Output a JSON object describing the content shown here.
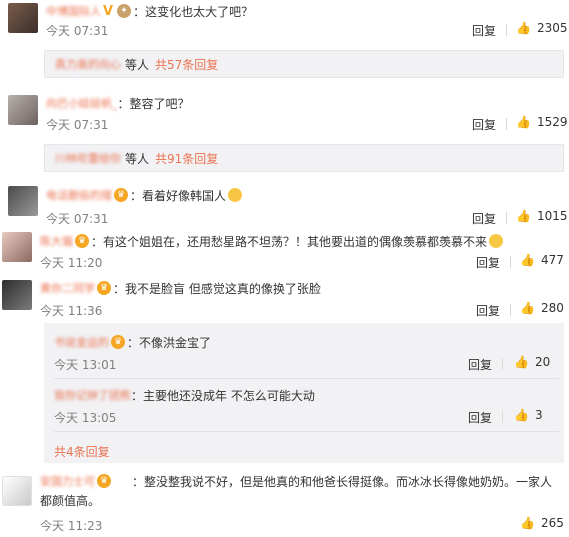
{
  "comments": [
    {
      "username": "中博国际人",
      "text": "：这变化也太大了吧？",
      "time": "今天 07:31",
      "reply_label": "回复",
      "likes": "2305",
      "reply_summary": {
        "users": "真力奥的向心",
        "suffix": "等人",
        "count_label": "共57条回复"
      }
    },
    {
      "username": "向巴小娃娃帆_",
      "text": "：整容了吧？",
      "time": "今天 07:31",
      "reply_label": "回复",
      "likes": "1529",
      "reply_summary": {
        "users": "川林吹蕾给你",
        "suffix": "等人",
        "count_label": "共91条回复"
      }
    },
    {
      "username": "电话删俗的摆",
      "text": "：看着好像韩国人",
      "time": "今天 07:31",
      "reply_label": "回复",
      "likes": "1015"
    },
    {
      "username": "陈大猫",
      "text": "：有这个姐姐在，还用愁星路不坦荡？！其他要出道的偶像羡慕都羡慕不来",
      "time": "今天 11:20",
      "reply_label": "回复",
      "likes": "477"
    },
    {
      "username": "黄你二同学",
      "text": "：我不是脸盲 但感觉这真的像换了张脸",
      "time": "今天 11:36",
      "reply_label": "回复",
      "likes": "280",
      "nested": [
        {
          "username": "书说金运的",
          "text": "：不像洪金宝了",
          "time": "今天 13:01",
          "reply_label": "回复",
          "likes": "20"
        },
        {
          "username": "我你记钟了团熊",
          "text": "：主要他还没成年 不怎么可能大动",
          "time": "今天 13:05",
          "reply_label": "回复",
          "likes": "3"
        }
      ],
      "more_label": "共4条回复"
    },
    {
      "username": "安国力士可",
      "text": "：整没整我说不好，但是他真的和他爸长得挺像。而冰冰长得像她奶奶。一家人都颜值高。",
      "time": "今天 11:23",
      "reply_label": "回复",
      "likes": "265"
    }
  ],
  "colors": {
    "accent": "#eb7350",
    "time": "#808080",
    "reply_bg": "#f2f2f5"
  }
}
